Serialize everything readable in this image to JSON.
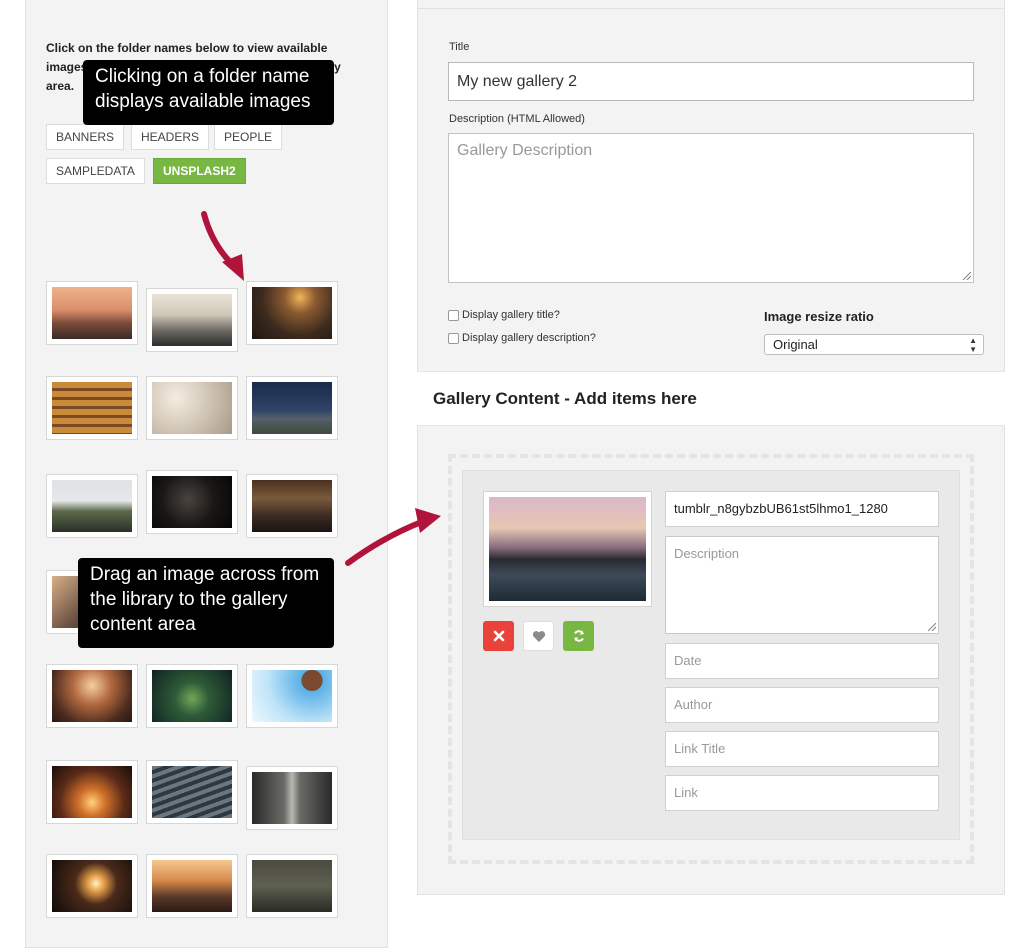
{
  "left_panel": {
    "intro_text": "Click on the folder names below to view available images. Drag and drop images across to the gallery area.",
    "folders": [
      {
        "label": "BANNERS",
        "active": false
      },
      {
        "label": "HEADERS",
        "active": false
      },
      {
        "label": "PEOPLE",
        "active": false
      },
      {
        "label": "SAMPLEDATA",
        "active": false
      },
      {
        "label": "UNSPLASH2",
        "active": true
      }
    ],
    "thumbnails": [
      "golden-gate-bridge-sunset",
      "mountain-clouds",
      "field-grass-sunset",
      "stairs-feet",
      "foggy-birds",
      "road-field-night",
      "snowy-hill",
      "dark-hand",
      "crowded-bar",
      "train-track",
      "couple-sunset",
      "green-plant",
      "hot-air-balloon",
      "city-street-sunset",
      "typewriter",
      "old-street",
      "sparkler",
      "railroad-sunset",
      "old-building"
    ]
  },
  "right_panel": {
    "title_label": "Title",
    "title_value": "My new gallery 2",
    "description_label": "Description (HTML Allowed)",
    "description_placeholder": "Gallery Description",
    "display_title_label": "Display gallery title?",
    "display_description_label": "Display gallery description?",
    "resize_label": "Image resize ratio",
    "resize_value": "Original",
    "section_title": "Gallery Content - Add items here",
    "item": {
      "filename": "tumblr_n8gybzbUB61st5lhmo1_1280",
      "description_placeholder": "Description",
      "date_placeholder": "Date",
      "author_placeholder": "Author",
      "link_title_placeholder": "Link Title",
      "link_placeholder": "Link"
    }
  },
  "tooltips": {
    "folder_tip": "Clicking on a folder name displays available images",
    "drag_tip": "Drag an image across from the library to the gallery content area"
  },
  "colors": {
    "accent_green": "#78b742",
    "delete_red": "#e8423a",
    "annotation_arrow": "#b0143a"
  }
}
